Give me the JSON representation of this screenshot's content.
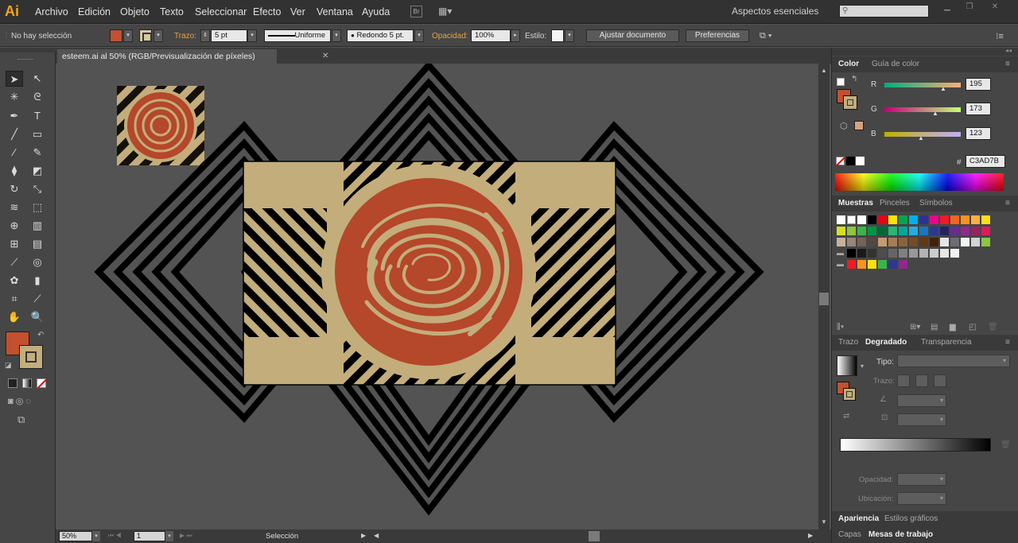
{
  "app": {
    "logo": "Ai"
  },
  "menu": [
    "Archivo",
    "Edición",
    "Objeto",
    "Texto",
    "Seleccionar",
    "Efecto",
    "Ver",
    "Ventana",
    "Ayuda"
  ],
  "workspace": "Aspectos esenciales",
  "control": {
    "selection_status": "No hay selección",
    "stroke_label": "Trazo:",
    "stroke_weight": "5 pt",
    "stroke_profile": "Uniforme",
    "brush": "Redondo 5 pt.",
    "opacity_label": "Opacidad:",
    "opacity": "100%",
    "style_label": "Estilo:",
    "fit_document": "Ajustar documento",
    "preferences": "Preferencias"
  },
  "document": {
    "tab_title": "esteem.ai al 50% (RGB/Previsualización de píxeles)"
  },
  "statusbar": {
    "zoom": "50%",
    "artboard_number": "1",
    "tool_status": "Selección"
  },
  "color_panel": {
    "tabs": [
      "Color",
      "Guía de color"
    ],
    "r": "195",
    "g": "173",
    "b": "123",
    "r_label": "R",
    "g_label": "G",
    "b_label": "B",
    "hex_label": "#",
    "hex": "C3AD7B"
  },
  "swatches_panel": {
    "tabs": [
      "Muestras",
      "Pinceles",
      "Símbolos"
    ]
  },
  "gradient_panel": {
    "tabs": [
      "Trazo",
      "Degradado",
      "Transparencia"
    ],
    "type_label": "Tipo:",
    "stroke_label": "Trazo:",
    "opacity_label": "Opacidad:",
    "location_label": "Ubicación:"
  },
  "bottom_tabs_1": [
    "Apariencia",
    "Estilos gráficos"
  ],
  "bottom_tabs_2": [
    "Capas",
    "Mesas de trabajo"
  ],
  "colors": {
    "fill": "#c3502f",
    "stroke": "#c3ad7b",
    "artboard_bg": "#c3ad7b",
    "accent_orange": "#f7a21b"
  }
}
